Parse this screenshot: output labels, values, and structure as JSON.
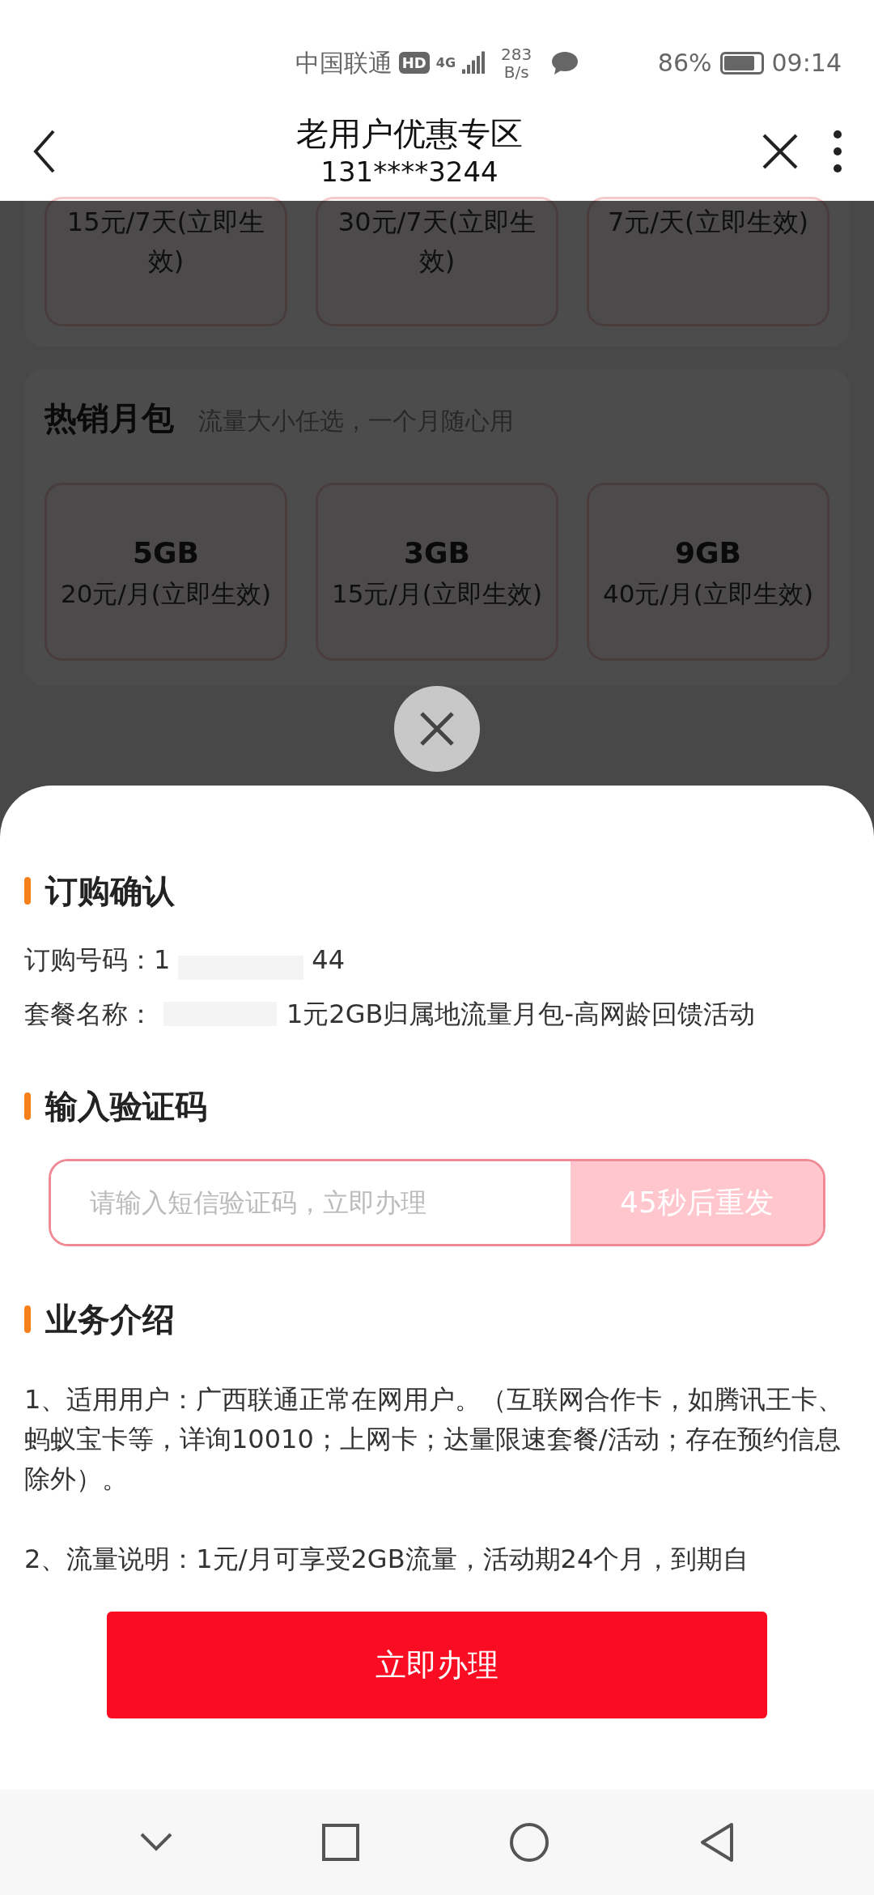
{
  "status_bar": {
    "carrier": "中国联通",
    "hd": "HD",
    "network": "4G",
    "speed_value": "283",
    "speed_unit": "B/s",
    "battery": "86%",
    "time": "09:14"
  },
  "header": {
    "title": "老用户优惠专区",
    "subtitle": "131****3244"
  },
  "background": {
    "top_cards": [
      "15元/7天(立即生效)",
      "30元/7天(立即生效)",
      "7元/天(立即生效)"
    ],
    "monthly": {
      "title": "热销月包",
      "subtitle": "流量大小任选，一个月随心用",
      "cards": [
        {
          "size": "5GB",
          "price": "20元/月(立即生效)"
        },
        {
          "size": "3GB",
          "price": "15元/月(立即生效)"
        },
        {
          "size": "9GB",
          "price": "40元/月(立即生效)"
        }
      ]
    }
  },
  "sheet": {
    "confirm_title": "订购确认",
    "order_number": {
      "label": "订购号码：",
      "start": "1",
      "end": "44"
    },
    "package": {
      "label": "套餐名称：",
      "value": "1元2GB归属地流量月包-高网龄回馈活动"
    },
    "code_title": "输入验证码",
    "code_field": {
      "placeholder": "请输入短信验证码，立即办理",
      "resend": "45秒后重发",
      "disabled": true
    },
    "intro_title": "业务介绍",
    "intro": [
      "1、适用用户：广西联通正常在网用户。（互联网合作卡，如腾讯王卡、蚂蚁宝卡等，详询10010；上网卡；达量限速套餐/活动；存在预约信息除外）。",
      "2、流量说明：1元/月可享受2GB流量，活动期24个月，到期自"
    ],
    "submit": "立即办理"
  }
}
